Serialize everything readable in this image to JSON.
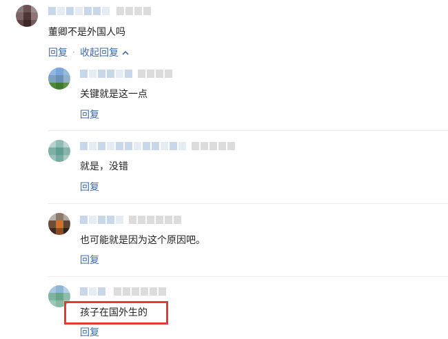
{
  "colors": {
    "link": "#3d6aa8",
    "highlight": "#e13b35",
    "divider": "#ececec"
  },
  "main_comment": {
    "text": "董卿不是外国人吗",
    "reply_label": "回复",
    "collapse_label": "收起回复",
    "separator": "·"
  },
  "replies": [
    {
      "text": "关键就是这一点",
      "reply_label": "回复"
    },
    {
      "text": "就是，没错",
      "reply_label": "回复"
    },
    {
      "text": "也可能就是因为这个原因吧。",
      "reply_label": "回复"
    },
    {
      "text": "孩子在国外生的",
      "reply_label": "回复",
      "highlighted": true
    }
  ]
}
